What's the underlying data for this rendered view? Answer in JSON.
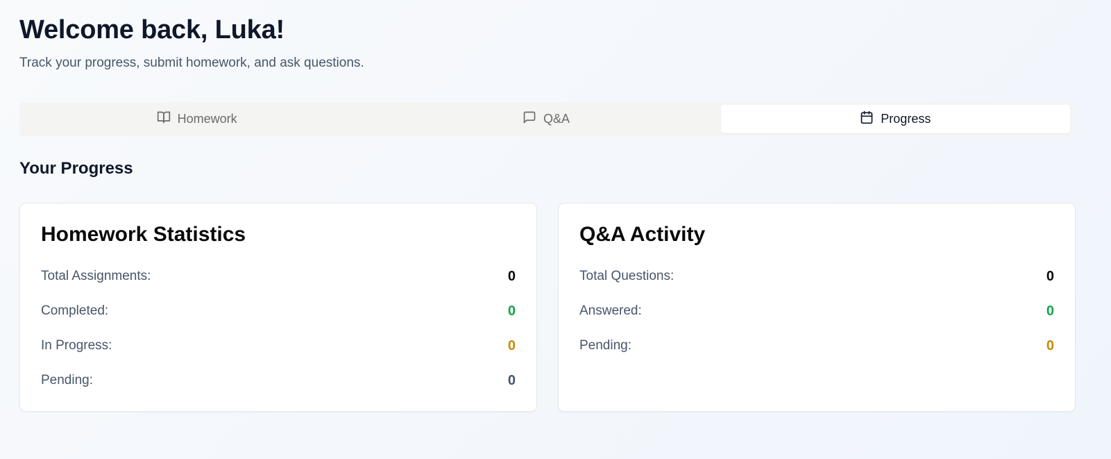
{
  "header": {
    "title": "Welcome back, Luka!",
    "subtitle": "Track your progress, submit homework, and ask questions."
  },
  "tabs": [
    {
      "label": "Homework",
      "icon": "book-open-icon",
      "active": false
    },
    {
      "label": "Q&A",
      "icon": "message-square-icon",
      "active": false
    },
    {
      "label": "Progress",
      "icon": "calendar-icon",
      "active": true
    }
  ],
  "section_title": "Your Progress",
  "homework_stats": {
    "title": "Homework Statistics",
    "rows": [
      {
        "label": "Total Assignments:",
        "value": "0",
        "color": "#0a0a0a"
      },
      {
        "label": "Completed:",
        "value": "0",
        "color": "#16a34a"
      },
      {
        "label": "In Progress:",
        "value": "0",
        "color": "#ca8a04"
      },
      {
        "label": "Pending:",
        "value": "0",
        "color": "#475569"
      }
    ]
  },
  "qa_activity": {
    "title": "Q&A Activity",
    "rows": [
      {
        "label": "Total Questions:",
        "value": "0",
        "color": "#0a0a0a"
      },
      {
        "label": "Answered:",
        "value": "0",
        "color": "#16a34a"
      },
      {
        "label": "Pending:",
        "value": "0",
        "color": "#ca8a04"
      }
    ]
  }
}
